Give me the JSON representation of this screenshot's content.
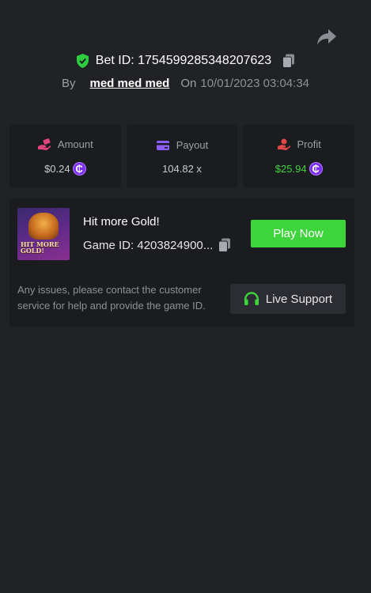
{
  "header": {
    "bet_id_label": "Bet ID: 1754599285348207623",
    "by_label": "By",
    "username": "med med med",
    "on_label": "On",
    "date": "10/01/2023 03:04:34"
  },
  "stats": [
    {
      "label": "Amount",
      "value": "$0.24",
      "icon": "hand-money-icon",
      "has_coin": true,
      "value_color": "#c9cbcf"
    },
    {
      "label": "Payout",
      "value": "104.82 x",
      "icon": "wallet-icon",
      "has_coin": false,
      "value_color": "#c9cbcf"
    },
    {
      "label": "Profit",
      "value": "$25.94",
      "icon": "hand-coin-icon",
      "has_coin": true,
      "value_color": "#3ed43c"
    }
  ],
  "coin_symbol": "₵",
  "game": {
    "title": "Hit more Gold!",
    "thumb_text": "HIT MORE GOLD!",
    "game_id": "Game ID: 4203824900...",
    "play_label": "Play Now"
  },
  "support": {
    "message": "Any issues, please contact the customer service for help and provide the game ID.",
    "button_label": "Live Support"
  },
  "colors": {
    "background": "#212226",
    "panel": "#1b1c20",
    "accent_green": "#3ed43c",
    "coin_purple": "#7b2ff0",
    "shield_green": "#2ecc40",
    "payout_icon": "#8b5cf6",
    "amount_icon": "#e0457b",
    "profit_icon": "#e04848"
  }
}
